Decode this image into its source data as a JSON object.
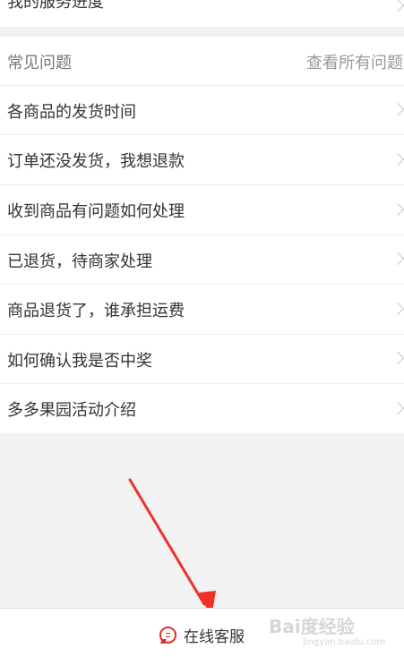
{
  "top_item": {
    "label": "我的服务进度"
  },
  "faq": {
    "title": "常见问题",
    "view_all": "查看所有问题",
    "items": [
      {
        "label": "各商品的发货时间"
      },
      {
        "label": "订单还没发货，我想退款"
      },
      {
        "label": "收到商品有问题如何处理"
      },
      {
        "label": "已退货，待商家处理"
      },
      {
        "label": "商品退货了，谁承担运费"
      },
      {
        "label": "如何确认我是否中奖"
      },
      {
        "label": "多多果园活动介绍"
      }
    ]
  },
  "bottom_bar": {
    "online_service_label": "在线客服",
    "icon": "chat-list-icon"
  },
  "watermark": {
    "brand": "Bai度经验",
    "url": "jingyan.baidu.com"
  },
  "colors": {
    "accent": "#e02e24",
    "background": "#f2f2f2",
    "text": "#333333",
    "muted": "#999999"
  }
}
